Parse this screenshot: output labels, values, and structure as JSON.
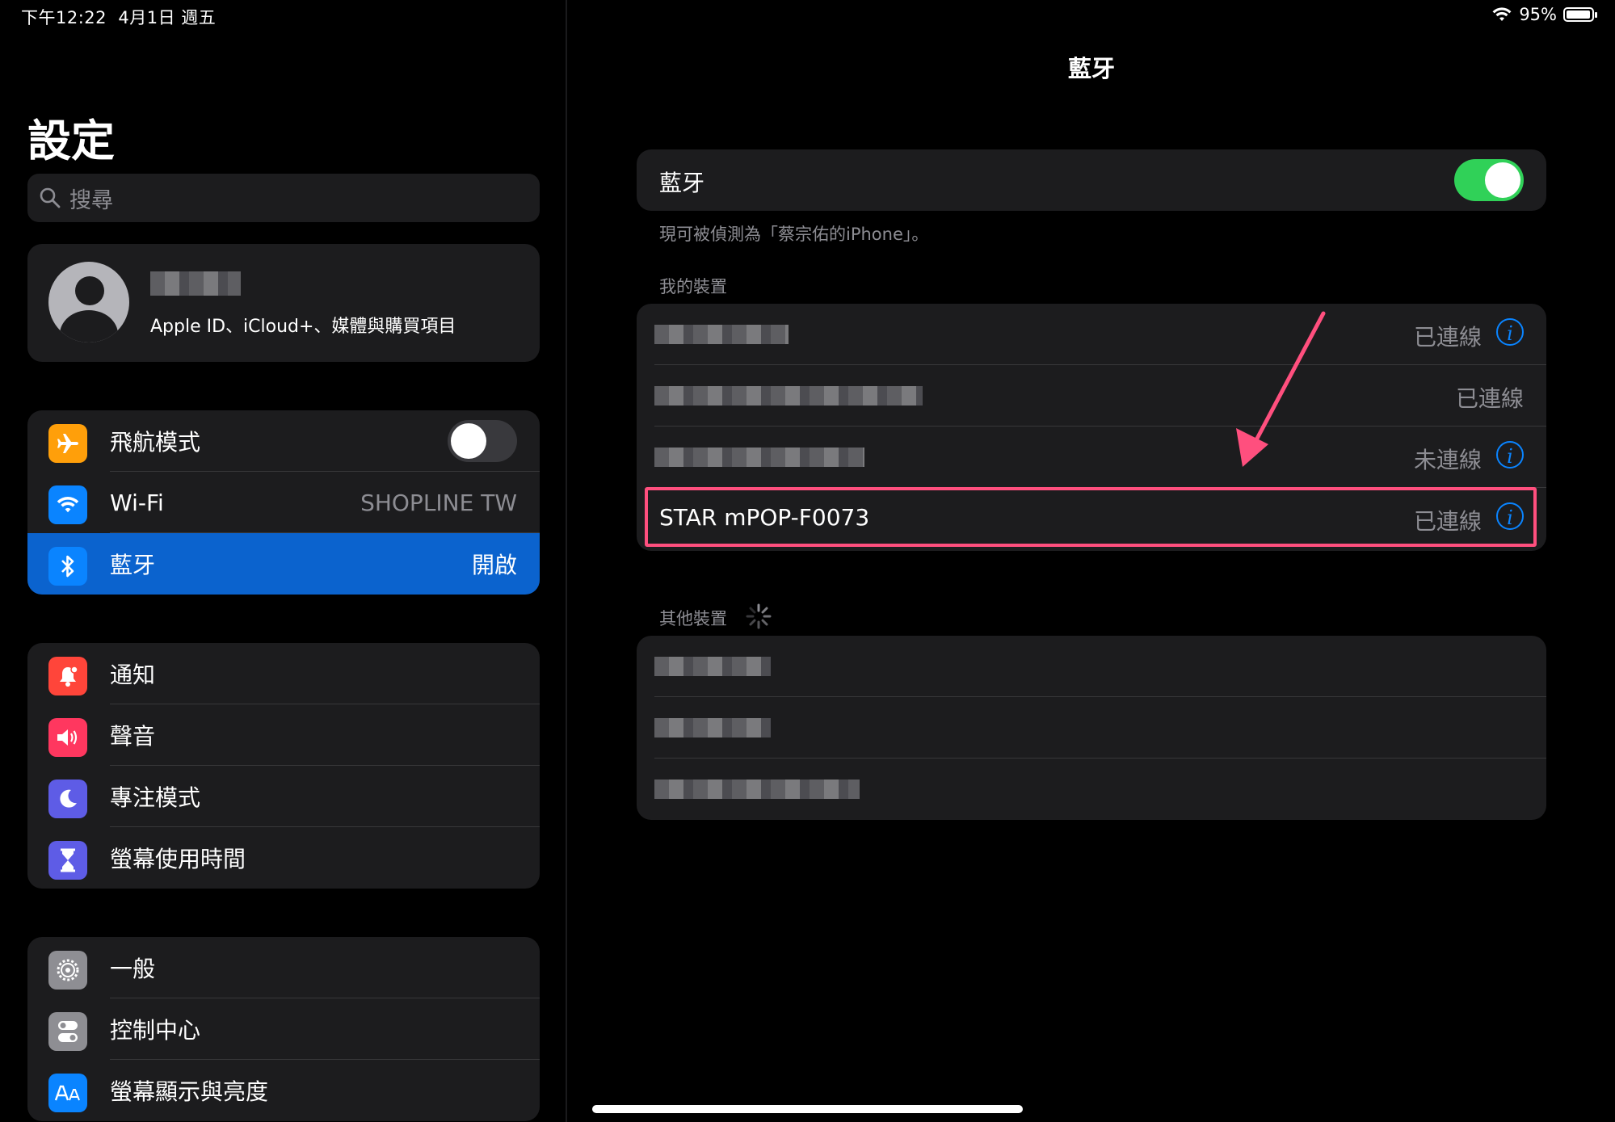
{
  "status_bar": {
    "time": "下午12:22",
    "date": "4月1日 週五",
    "battery": "95%",
    "battery_level": 0.95
  },
  "sidebar": {
    "title": "設定",
    "search_placeholder": "搜尋",
    "profile": {
      "subtitle": "Apple ID、iCloud+、媒體與購買項目"
    },
    "group1": [
      {
        "label": "飛航模式",
        "icon": "airplane-icon",
        "color": "#ff9f0a",
        "toggle": false
      },
      {
        "label": "Wi-Fi",
        "icon": "wifi-icon",
        "color": "#0a84ff",
        "value": "SHOPLINE TW"
      },
      {
        "label": "藍牙",
        "icon": "bluetooth-icon",
        "color": "#0a84ff",
        "value": "開啟",
        "selected": true
      }
    ],
    "group2": [
      {
        "label": "通知",
        "icon": "bell-icon",
        "color": "#ff453a"
      },
      {
        "label": "聲音",
        "icon": "speaker-icon",
        "color": "#ff375f"
      },
      {
        "label": "專注模式",
        "icon": "moon-icon",
        "color": "#5e5ce6"
      },
      {
        "label": "螢幕使用時間",
        "icon": "hourglass-icon",
        "color": "#5e5ce6"
      }
    ],
    "group3": [
      {
        "label": "一般",
        "icon": "gear-icon",
        "color": "#8e8e93"
      },
      {
        "label": "控制中心",
        "icon": "toggles-icon",
        "color": "#8e8e93"
      },
      {
        "label": "螢幕顯示與亮度",
        "icon": "aa-icon",
        "color": "#0a84ff"
      }
    ]
  },
  "detail": {
    "title": "藍牙",
    "bluetooth_label": "藍牙",
    "bluetooth_on": true,
    "discoverable_caption": "現可被偵測為「蔡宗佑的iPhone」。",
    "my_devices_header": "我的裝置",
    "my_devices": [
      {
        "status": "已連線",
        "has_info": true
      },
      {
        "status": "已連線",
        "has_info": false
      },
      {
        "status": "未連線",
        "has_info": true
      },
      {
        "name": "STAR mPOP-F0073",
        "status": "已連線",
        "has_info": true
      }
    ],
    "other_devices_header": "其他裝置"
  },
  "colors": {
    "toggle_on": "#30d158",
    "toggle_off": "#39393d",
    "highlight": "#ff4f7e",
    "accent": "#0a84ff"
  }
}
